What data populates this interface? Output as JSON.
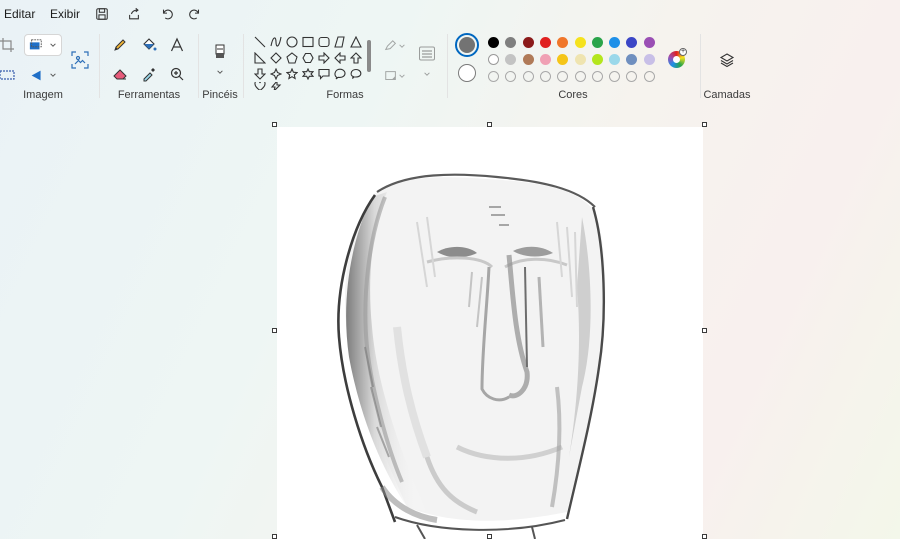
{
  "menu": {
    "edit": "Editar",
    "view": "Exibir"
  },
  "quick_access": [
    "save-icon",
    "share-icon",
    "undo-icon",
    "redo-icon"
  ],
  "groups": {
    "image": "Imagem",
    "tools": "Ferramentas",
    "brushes": "Pincéis",
    "shapes": "Formas",
    "colors": "Cores",
    "layers": "Camadas"
  },
  "colors": {
    "primary": "#737373",
    "secondary": "#ffffff",
    "palette_row1": [
      "#000000",
      "#7f7f7f",
      "#8b1a1a",
      "#e02020",
      "#f0762a",
      "#f5e21d",
      "#2aa44a",
      "#1e90e8",
      "#3b46c6",
      "#9a4fb4"
    ],
    "palette_row2": [
      "#ffffff",
      "#c3c3c3",
      "#b07a58",
      "#f0a0b4",
      "#f5c518",
      "#efe4b0",
      "#b4e61d",
      "#9ad8ea",
      "#6f8fbf",
      "#c8bfe7"
    ],
    "accent": "#0067c0"
  }
}
